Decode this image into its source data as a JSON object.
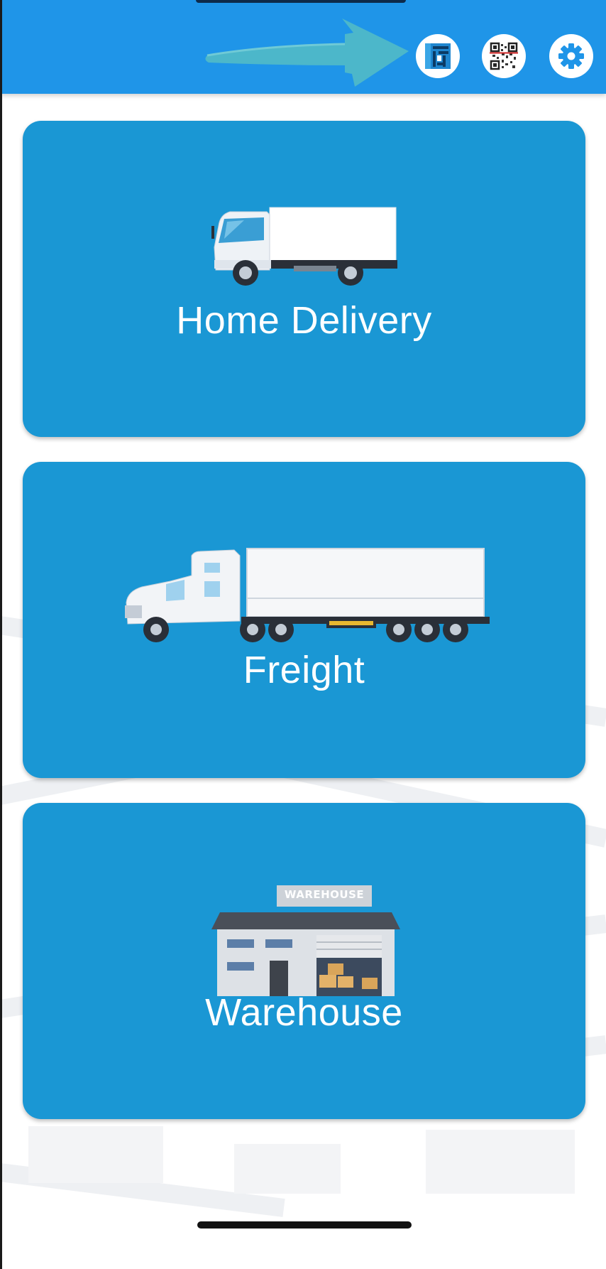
{
  "app": {
    "colors": {
      "header": "#1f95e8",
      "card": "#1a97d4",
      "arrow": "#4fb8c8"
    }
  },
  "header": {
    "actions": [
      {
        "id": "layout",
        "icon": "layout-grid-icon"
      },
      {
        "id": "scan",
        "icon": "qr-code-icon"
      },
      {
        "id": "settings",
        "icon": "gear-icon"
      }
    ]
  },
  "cards": [
    {
      "label": "Home Delivery",
      "icon": "box-truck-icon"
    },
    {
      "label": "Freight",
      "icon": "semi-truck-icon"
    },
    {
      "label": "Warehouse",
      "icon": "warehouse-icon",
      "sign_text": "WAREHOUSE"
    }
  ]
}
